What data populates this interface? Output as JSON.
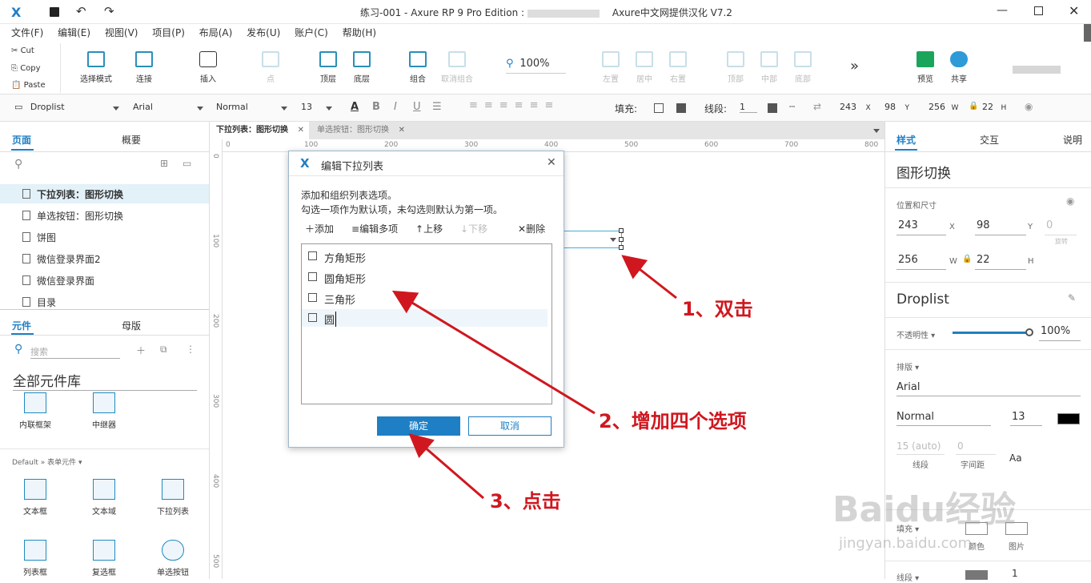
{
  "window": {
    "title": "练习-001 - Axure RP 9 Pro Edition : ",
    "title_suffix": "Axure中文网提供汉化 V7.2"
  },
  "menu": [
    "文件(F)",
    "编辑(E)",
    "视图(V)",
    "项目(P)",
    "布局(A)",
    "发布(U)",
    "账户(C)",
    "帮助(H)"
  ],
  "clipboard": {
    "cut": "Cut",
    "copy": "Copy",
    "paste": "Paste"
  },
  "toolbar": {
    "select_mode": "选择模式",
    "connect": "连接",
    "insert": "插入",
    "point": "点",
    "top_layer": "顶层",
    "bottom_layer": "底层",
    "group": "组合",
    "ungroup": "取消组合",
    "zoom": "100%",
    "align_left": "左置",
    "align_center": "居中",
    "align_right": "右置",
    "align_top": "顶部",
    "align_middle": "中部",
    "align_bottom": "底部",
    "more": "»",
    "preview": "预览",
    "share": "共享"
  },
  "format": {
    "widget_type": "Droplist",
    "font": "Arial",
    "weight": "Normal",
    "size": "13",
    "fill_label": "填充:",
    "stroke_label": "线段:",
    "stroke_value": "1",
    "x": "243",
    "x_label": "X",
    "y": "98",
    "y_label": "Y",
    "w": "256",
    "w_label": "W",
    "h": "22",
    "h_label": "H"
  },
  "left_panel": {
    "tab_pages": "页面",
    "tab_outline": "概要",
    "pages": [
      "下拉列表：图形切换",
      "单选按钮：图形切换",
      "饼图",
      "微信登录界面2",
      "微信登录界面",
      "目录"
    ],
    "tab_widgets": "元件",
    "tab_masters": "母版",
    "search_placeholder": "搜索",
    "library": "全部元件库",
    "widgets_top": [
      "内联框架",
      "中继器"
    ],
    "section": "Default » 表单元件 ▾",
    "widgets_form": [
      "文本框",
      "文本域",
      "下拉列表",
      "列表框",
      "复选框",
      "单选按钮"
    ]
  },
  "tabs": [
    "下拉列表：图形切换",
    "单选按钮：图形切换"
  ],
  "rulers": {
    "h": [
      "0",
      "100",
      "200",
      "300",
      "400",
      "500",
      "600",
      "700",
      "800"
    ],
    "v": [
      "0",
      "100",
      "200",
      "300",
      "400",
      "500"
    ]
  },
  "dialog": {
    "title": "编辑下拉列表",
    "desc1": "添加和组织列表选项。",
    "desc2": "勾选一项作为默认项，未勾选则默认为第一项。",
    "add": "添加",
    "edit_multi": "编辑多项",
    "move_up": "上移",
    "move_down": "下移",
    "delete": "删除",
    "options": [
      "方角矩形",
      "圆角矩形",
      "三角形",
      "圆"
    ],
    "ok": "确定",
    "cancel": "取消"
  },
  "annotations": [
    "1、双击",
    "2、增加四个选项",
    "3、点击"
  ],
  "right_panel": {
    "tab_style": "样式",
    "tab_interact": "交互",
    "tab_notes": "说明",
    "page_name": "图形切换",
    "pos_size": "位置和尺寸",
    "x": "243",
    "y": "98",
    "rot": "0",
    "rot_label": "旋转",
    "w": "256",
    "h": "22",
    "x_label": "X",
    "y_label": "Y",
    "w_label": "W",
    "h_label": "H",
    "style_name": "Droplist",
    "opacity_label": "不透明性 ▾",
    "opacity": "100%",
    "opacity_level": 1.0,
    "typography_label": "排版 ▾",
    "font": "Arial",
    "weight": "Normal",
    "size": "13",
    "line_height": "15 (auto)",
    "letter_spacing": "0",
    "line_label": "线段",
    "spacing_label": "字间距",
    "fill_label": "填充 ▾",
    "color_label": "颜色",
    "image_label": "图片",
    "stroke_label": "线段 ▾",
    "stroke_value": "1"
  },
  "colors": {
    "accent": "#1f7fc4",
    "annotation": "#d0171f",
    "selection": "#3fb0d8"
  },
  "watermark": "Baidu经验",
  "watermark_sub": "jingyan.baidu.com"
}
